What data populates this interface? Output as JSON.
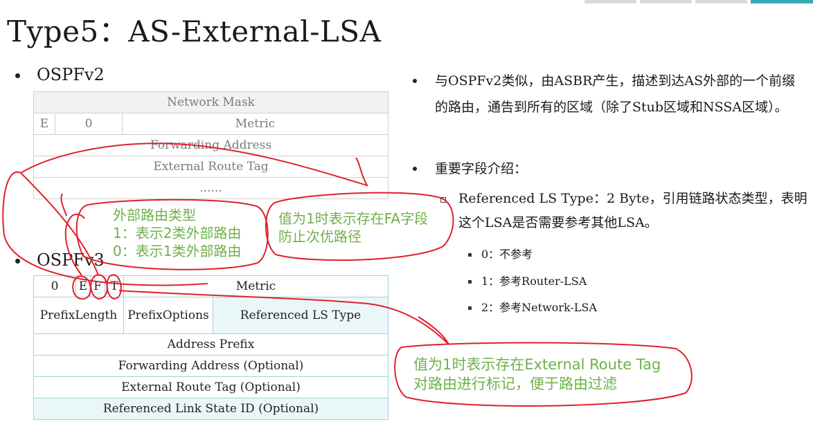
{
  "title": "Type5：AS-External-LSA",
  "ospfv2": {
    "label": "OSPFv2",
    "rows": {
      "network_mask": "Network Mask",
      "e": "E",
      "zero": "0",
      "metric": "Metric",
      "forwarding_address": "Forwarding Address",
      "external_route_tag": "External Route Tag",
      "ellipsis": "......"
    }
  },
  "ospfv3": {
    "label": "OSPFv3",
    "rows": {
      "zero": "0",
      "e": "E",
      "f": "F",
      "t": "T",
      "metric": "Metric",
      "prefix_length": "PrefixLength",
      "prefix_options": "PrefixOptions",
      "referenced_ls_type": "Referenced LS Type",
      "address_prefix": "Address Prefix",
      "forwarding_address_optional": "Forwarding Address (Optional)",
      "external_route_tag_optional": "External Route Tag (Optional)",
      "referenced_link_state_id_optional": "Referenced Link State ID (Optional)"
    }
  },
  "right": {
    "bullet1": "与OSPFv2类似，由ASBR产生，描述到达AS外部的一个前缀的路由，通告到所有的区域（除了Stub区域和NSSA区域）。",
    "bullet2": "重要字段介绍：",
    "sub1": "Referenced LS Type：2 Byte，引用链路状态类型，表明这个LSA是否需要参考其他LSA。",
    "items": [
      "0：不参考",
      "1：参考Router-LSA",
      "2：参考Network-LSA"
    ]
  },
  "annotations": {
    "e_bit": [
      "外部路由类型",
      "1：表示2类外部路由",
      "0：表示1类外部路由"
    ],
    "f_bit": [
      "值为1时表示存在FA字段",
      "防止次优路径"
    ],
    "t_bit": [
      "值为1时表示存在External Route Tag",
      "对路由进行标记，便于路由过滤"
    ]
  },
  "colors": {
    "annotation_text": "#6fb04a",
    "annotation_ink": "#e0202a",
    "accent_bar": "#3aa7b6",
    "v3_table_border": "#9fd3da"
  }
}
